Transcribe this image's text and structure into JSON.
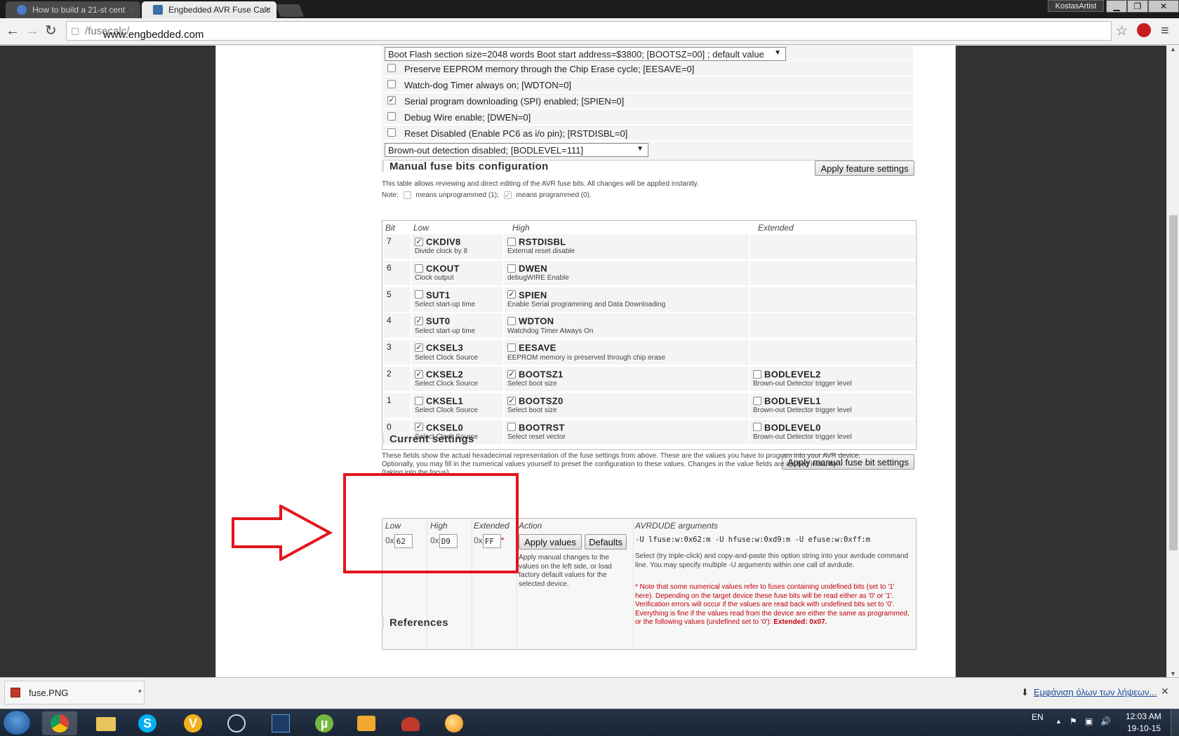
{
  "browser": {
    "tabs": [
      {
        "title": "How to build a 21-st cent",
        "active": false
      },
      {
        "title": "Engbedded AVR Fuse Calc",
        "active": true
      }
    ],
    "profile": "KostasArtist",
    "url_host": "www.engbedded.com",
    "url_path": "/fusecalc/"
  },
  "features": {
    "boot_select": "Boot Flash section size=2048 words Boot start address=$3800; [BOOTSZ=00] ; default value",
    "items": [
      {
        "label": "Preserve EEPROM memory through the Chip Erase cycle; [EESAVE=0]",
        "checked": false
      },
      {
        "label": "Watch-dog Timer always on; [WDTON=0]",
        "checked": false
      },
      {
        "label": "Serial program downloading (SPI) enabled; [SPIEN=0]",
        "checked": true
      },
      {
        "label": "Debug Wire enable; [DWEN=0]",
        "checked": false
      },
      {
        "label": "Reset Disabled (Enable PC6 as i/o pin); [RSTDISBL=0]",
        "checked": false
      }
    ],
    "bod_select": "Brown-out detection disabled; [BODLEVEL=111]",
    "apply_label": "Apply feature settings"
  },
  "manual": {
    "title": "Manual fuse bits configuration",
    "desc": "This table allows reviewing and direct editing of the AVR fuse bits. All changes will be applied instantly.",
    "note_prefix": "Note:",
    "note_unprog": "means unprogrammed (1);",
    "note_prog": "means programmed (0).",
    "headers": {
      "bit": "Bit",
      "low": "Low",
      "high": "High",
      "ext": "Extended"
    },
    "rows": [
      {
        "bit": "7",
        "low": {
          "name": "CKDIV8",
          "desc": "Divide clock by 8",
          "checked": true
        },
        "high": {
          "name": "RSTDISBL",
          "desc": "External reset disable",
          "checked": false
        },
        "ext": null
      },
      {
        "bit": "6",
        "low": {
          "name": "CKOUT",
          "desc": "Clock output",
          "checked": false
        },
        "high": {
          "name": "DWEN",
          "desc": "debugWIRE Enable",
          "checked": false
        },
        "ext": null
      },
      {
        "bit": "5",
        "low": {
          "name": "SUT1",
          "desc": "Select start-up time",
          "checked": false
        },
        "high": {
          "name": "SPIEN",
          "desc": "Enable Serial programming and Data Downloading",
          "checked": true
        },
        "ext": null
      },
      {
        "bit": "4",
        "low": {
          "name": "SUT0",
          "desc": "Select start-up time",
          "checked": true
        },
        "high": {
          "name": "WDTON",
          "desc": "Watchdog Timer Always On",
          "checked": false
        },
        "ext": null
      },
      {
        "bit": "3",
        "low": {
          "name": "CKSEL3",
          "desc": "Select Clock Source",
          "checked": true
        },
        "high": {
          "name": "EESAVE",
          "desc": "EEPROM memory is preserved through chip erase",
          "checked": false
        },
        "ext": null
      },
      {
        "bit": "2",
        "low": {
          "name": "CKSEL2",
          "desc": "Select Clock Source",
          "checked": true
        },
        "high": {
          "name": "BOOTSZ1",
          "desc": "Select boot size",
          "checked": true
        },
        "ext": {
          "name": "BODLEVEL2",
          "desc": "Brown-out Detector trigger level",
          "checked": false
        }
      },
      {
        "bit": "1",
        "low": {
          "name": "CKSEL1",
          "desc": "Select Clock Source",
          "checked": false
        },
        "high": {
          "name": "BOOTSZ0",
          "desc": "Select boot size",
          "checked": true
        },
        "ext": {
          "name": "BODLEVEL1",
          "desc": "Brown-out Detector trigger level",
          "checked": false
        }
      },
      {
        "bit": "0",
        "low": {
          "name": "CKSEL0",
          "desc": "Select Clock Source",
          "checked": true
        },
        "high": {
          "name": "BOOTRST",
          "desc": "Select reset vector",
          "checked": false
        },
        "ext": {
          "name": "BODLEVEL0",
          "desc": "Brown-out Detector trigger level",
          "checked": false
        }
      }
    ],
    "apply_label": "Apply manual fuse bit settings"
  },
  "current": {
    "title": "Current settings",
    "desc1": "These fields show the actual hexadecimal representation of the fuse settings from above. These are the values you have to program into your AVR device.",
    "desc2": "Optionally, you may fill in the numerical values yourself to preset the configuration to these values. Changes in the value fields are applied instantly",
    "desc3": "(taking into the focus).",
    "headers": {
      "low": "Low",
      "high": "High",
      "ext": "Extended",
      "action": "Action",
      "avrdude": "AVRDUDE arguments"
    },
    "prefix": "0x",
    "low": "62",
    "high": "D9",
    "ext": "FF",
    "asterisk": "*",
    "apply_values": "Apply values",
    "defaults": "Defaults",
    "action_help": "Apply manual changes to the values on the left side, or load factory default values for the selected device.",
    "avrdude_args": "-U lfuse:w:0x62:m -U hfuse:w:0xd9:m -U efuse:w:0xff:m",
    "avrdude_help": "Select (try triple-click) and copy-and-paste this option string into your avrdude command line. You may specify multiple -U arguments within one call of avrdude.",
    "note": "* Note that some numerical values refer to fuses containing undefined bits (set to '1' here). Depending on the target device these fuse bits will be read either as '0' or '1'. Verification errors will occur if the values are read back with undefined bits set to '0'. Everything is fine if the values read from the device are either the same as programmed, or the following values (undefined set to '0'):",
    "note_value": "Extended: 0x07."
  },
  "references_title": "References",
  "downloads": {
    "file": "fuse.PNG",
    "show_all": "Εμφάνιση όλων των λήψεων..."
  },
  "taskbar": {
    "lang": "EN",
    "time": "12:03 AM",
    "date": "19-10-15"
  },
  "colors": {
    "annotation": "#e3161d",
    "note_red": "#c0000b"
  }
}
